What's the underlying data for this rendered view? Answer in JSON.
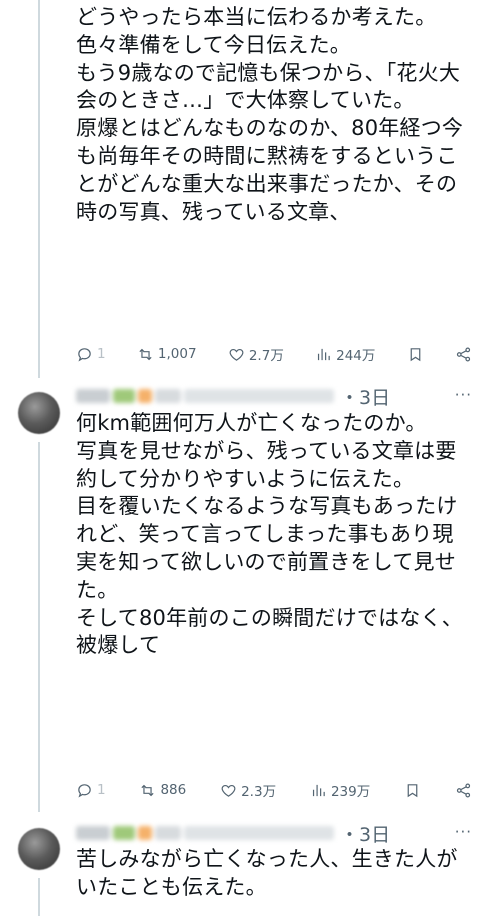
{
  "post1": {
    "text": "どうやったら本当に伝わるか考えた。色々準備をして今日伝えた。\nもう9歳なので記憶も保つから、「花火大会のときさ…」で大体察していた。\n原爆とはどんなものなのか、80年経つ今も尚毎年その時間に黙祷をするということがどんな重大な出来事だったか、その時の写真、残っている文章、",
    "reply_count": "1",
    "retweet_count": "1,007",
    "like_count": "2.7万",
    "view_count": "244万"
  },
  "post2": {
    "time": "・3日",
    "text": "何km範囲何万人が亡くなったのか。\n写真を見せながら、残っている文章は要約して分かりやすいように伝えた。\n目を覆いたくなるような写真もあったけれど、笑って言ってしまった事もあり現実を知って欲しいので前置きをして見せた。\nそして80年前のこの瞬間だけではなく、被爆して",
    "reply_count": "1",
    "retweet_count": "886",
    "like_count": "2.3万",
    "view_count": "239万"
  },
  "post3": {
    "time": "・3日",
    "text": "苦しみながら亡くなった人、生きた人がいたことも伝えた。"
  },
  "icons": {
    "reply": "reply-icon",
    "retweet": "retweet-icon",
    "like": "heart-icon",
    "views": "views-icon",
    "bookmark": "bookmark-icon",
    "share": "share-icon",
    "more": "more-icon"
  },
  "colors": {
    "text": "#0f1419",
    "secondary": "#536471",
    "thread_line": "#cfd9de"
  }
}
